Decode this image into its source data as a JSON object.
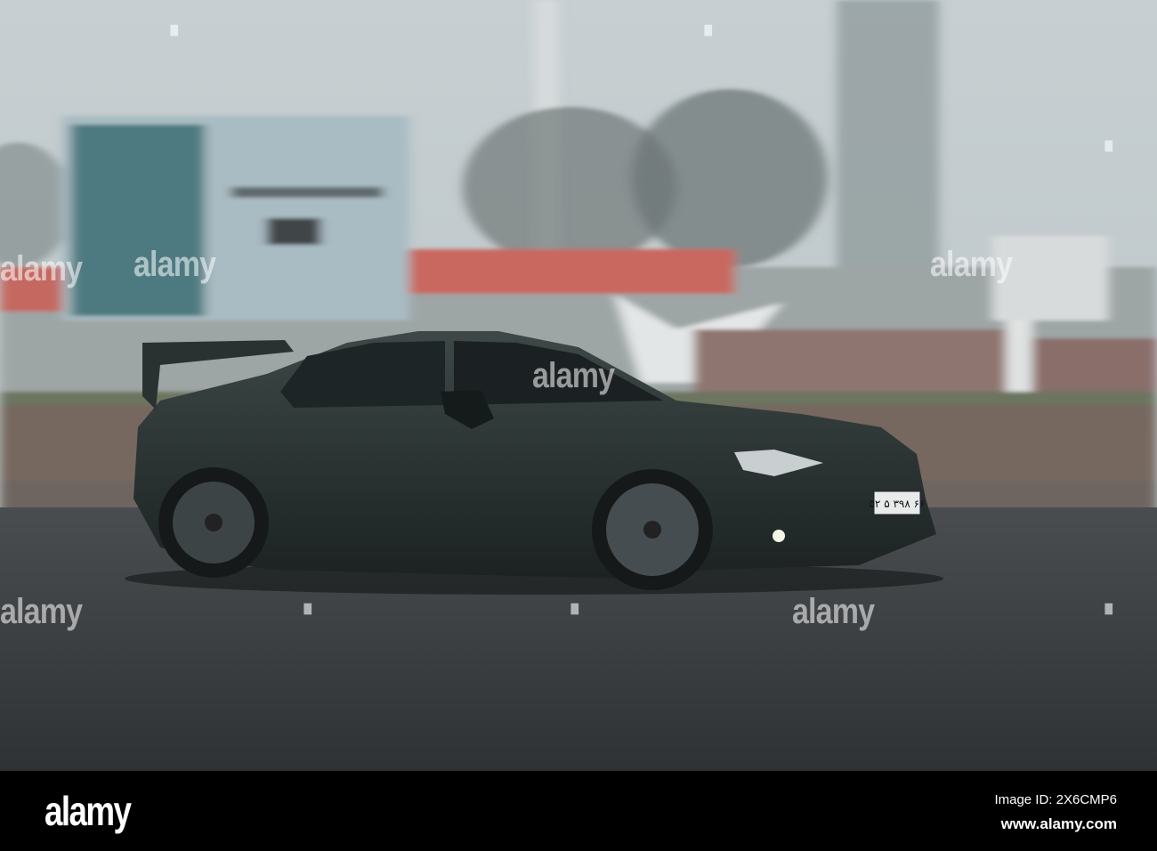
{
  "photo": {
    "subject": "car",
    "plate_text": "۵۲ ۵ ۳۹۸ ۶۶",
    "watermark_text": "alamy"
  },
  "footer": {
    "logo": "alamy",
    "image_id": "Image ID: 2X6CMP6",
    "website": "www.alamy.com"
  }
}
